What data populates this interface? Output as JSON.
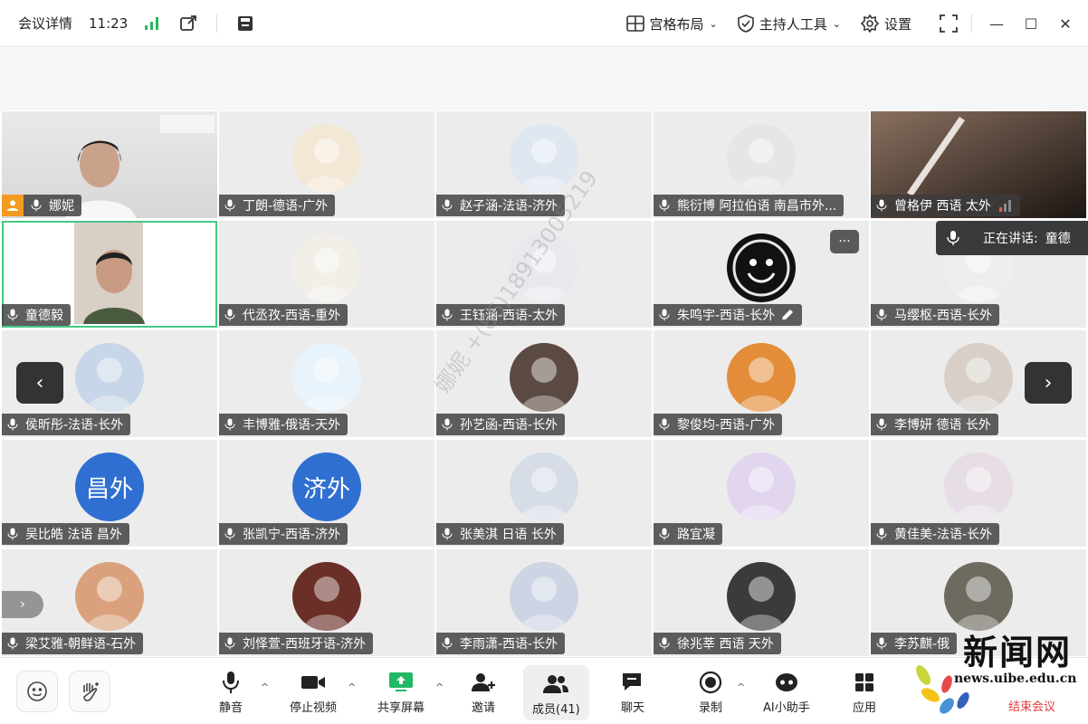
{
  "titlebar": {
    "meeting_details": "会议详情",
    "time": "11:23",
    "layout_label": "宫格布局",
    "host_tools_label": "主持人工具",
    "settings_label": "设置"
  },
  "tiles": [
    {
      "name": "娜妮"
    },
    {
      "name": "丁朗-德语-广外"
    },
    {
      "name": "赵子涵-法语-济外"
    },
    {
      "name": "熊衍博 阿拉伯语 南昌市外..."
    },
    {
      "name": "曾格伊 西语 太外"
    },
    {
      "name": "童德毅"
    },
    {
      "name": "代丞孜-西语-重外"
    },
    {
      "name": "王钰涵-西语-太外"
    },
    {
      "name": "朱鸣宇-西语-长外"
    },
    {
      "name": "马缨枢-西语-长外"
    },
    {
      "name": "侯昕彤-法语-长外"
    },
    {
      "name": "丰博雅-俄语-天外"
    },
    {
      "name": "孙艺函-西语-长外"
    },
    {
      "name": "黎俊均-西语-广外"
    },
    {
      "name": "李博妍 德语 长外"
    },
    {
      "name": "吴比皓 法语 昌外",
      "avatar_text": "昌外"
    },
    {
      "name": "张凯宁-西语-济外",
      "avatar_text": "济外"
    },
    {
      "name": "张美淇 日语 长外"
    },
    {
      "name": "路宜凝"
    },
    {
      "name": "黄佳美-法语-长外"
    },
    {
      "name": "梁艾雅-朝鲜语-石外"
    },
    {
      "name": "刘怿萱-西班牙语-济外"
    },
    {
      "name": "李雨潇-西语-长外"
    },
    {
      "name": "徐兆莘 西语 天外"
    },
    {
      "name": "李苏麒-俄"
    }
  ],
  "speaking": {
    "label": "正在讲话:",
    "name": "童德"
  },
  "more_label": "···",
  "watermark": "娜妮 +(86)18913005219",
  "toolbar": {
    "mute": "静音",
    "stop_video": "停止视频",
    "share_screen": "共享屏幕",
    "invite": "邀请",
    "members": "成员(41)",
    "chat": "聊天",
    "record": "录制",
    "ai_assistant": "AI小助手",
    "apps": "应用",
    "end_meeting": "结束会议"
  },
  "logo": {
    "cn": "新闻网",
    "url": "news.uibe.edu.cn"
  },
  "colors": {
    "active_green": "#43c987",
    "accent_blue": "#2f6fd1",
    "end_red": "#e03c3c",
    "signal_green": "#2db55d"
  }
}
